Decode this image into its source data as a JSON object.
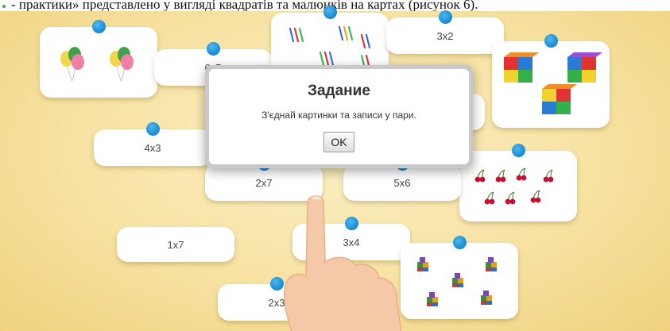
{
  "top_text": "- практики» представлено у вигляді квадратів та малюнків на картах (рисунок 6).",
  "dialog": {
    "title": "Задание",
    "message": "З'єднай картинки та записи у пари.",
    "ok_label": "OK"
  },
  "cards": {
    "text_3x2": "3x2",
    "text_6x5": "6x5",
    "text_4x3": "4x3",
    "text_2x7": "2x7",
    "text_5x6": "5x6",
    "text_1x7": "1x7",
    "text_3x4": "3x4",
    "text_2x3": "2x3"
  },
  "picture_cards": [
    {
      "name": "balloons-card",
      "content": "2 groups of 3 balloons"
    },
    {
      "name": "toothbrushes-card",
      "content": "groups of toothbrushes"
    },
    {
      "name": "cubes-card",
      "content": "3 groups of cubes"
    },
    {
      "name": "cherries-card",
      "content": "7 pairs of cherries"
    },
    {
      "name": "blocks-card",
      "content": "5 groups of blocks"
    }
  ],
  "colors": {
    "background": "#f7e2a2",
    "pin": "#1e8fd6",
    "card": "#ffffff"
  }
}
